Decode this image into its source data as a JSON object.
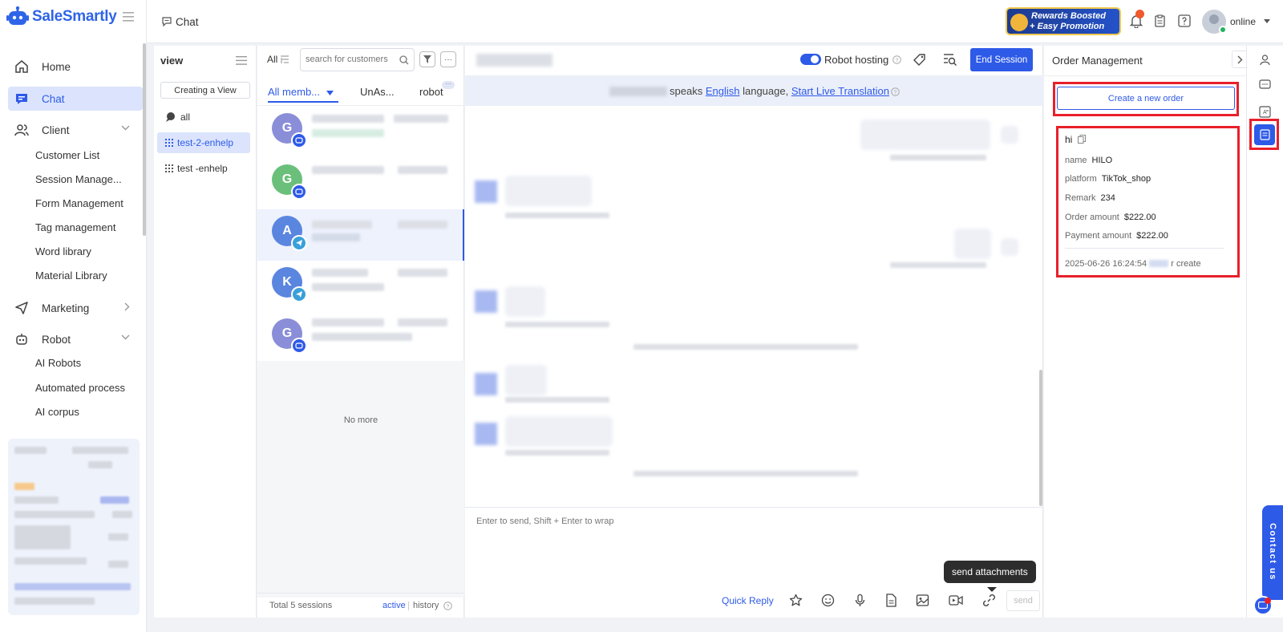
{
  "brand": {
    "name": "SaleSmartly"
  },
  "nav": {
    "home": "Home",
    "chat": "Chat",
    "client": "Client",
    "client_sub": [
      "Customer List",
      "Session Manage...",
      "Form Management",
      "Tag management",
      "Word library",
      "Material Library"
    ],
    "marketing": "Marketing",
    "robot": "Robot",
    "robot_sub": [
      "AI Robots",
      "Automated process",
      "AI corpus"
    ]
  },
  "topbar": {
    "breadcrumb": "Chat",
    "promo_line1": "Rewards Boosted",
    "promo_line2": "+ Easy Promotion",
    "status": "online"
  },
  "views": {
    "title": "view",
    "create_button": "Creating a View",
    "items": [
      "all",
      "test-2-enhelp",
      "test -enhelp"
    ]
  },
  "sessions": {
    "filter_all": "All",
    "search_placeholder": "search for customers",
    "tabs": [
      "All memb...",
      "UnAs...",
      "robot"
    ],
    "avatars": [
      "G",
      "G",
      "A",
      "K",
      "G"
    ],
    "no_more": "No more",
    "total": "Total 5 sessions",
    "active": "active",
    "history": "history"
  },
  "chat": {
    "robot_hosting": "Robot hosting",
    "end_session": "End Session",
    "speaks": "speaks",
    "language": "English",
    "language_suffix": "language,",
    "translation_link": "Start Live Translation",
    "input_placeholder": "Enter to send, Shift + Enter to wrap",
    "quick_reply": "Quick Reply",
    "send": "send",
    "tooltip": "send attachments"
  },
  "order": {
    "title": "Order Management",
    "create_button": "Create a new order",
    "card": {
      "heading": "hi",
      "fields": [
        {
          "label": "name",
          "value": "HILO"
        },
        {
          "label": "platform",
          "value": "TikTok_shop"
        },
        {
          "label": "Remark",
          "value": "234"
        },
        {
          "label": "Order amount",
          "value": "$222.00"
        },
        {
          "label": "Payment amount",
          "value": "$222.00"
        }
      ],
      "created": "2025-06-26 16:24:54",
      "created_suffix": "r create"
    }
  },
  "contact_tab": "Contact us",
  "colors": {
    "accent": "#2e5ae8",
    "highlight": "#e8202a"
  }
}
